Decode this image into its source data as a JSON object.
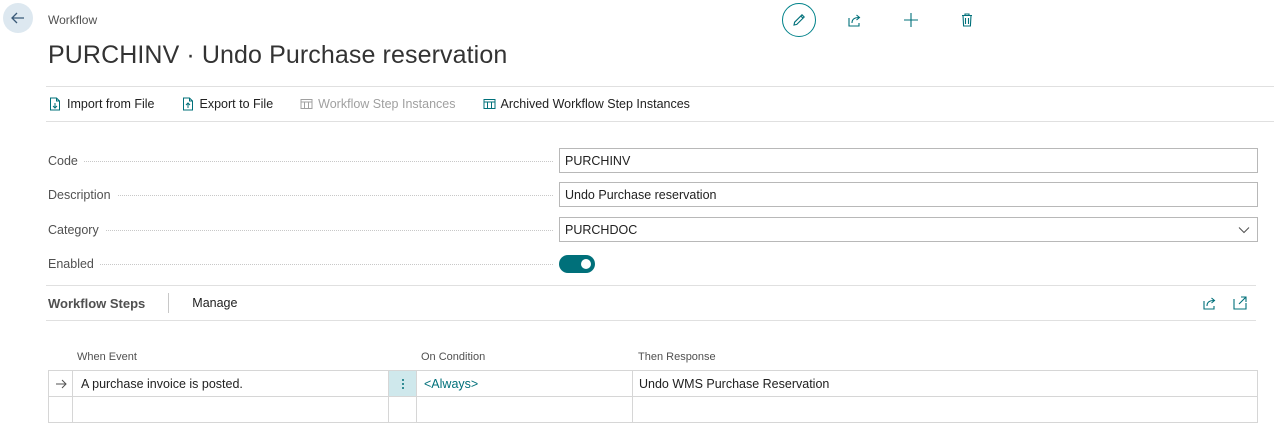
{
  "header": {
    "breadcrumb": "Workflow",
    "title": "PURCHINV · Undo Purchase reservation"
  },
  "actions": [
    {
      "label": "Import from File",
      "icon": "import-file-icon",
      "enabled": true
    },
    {
      "label": "Export to File",
      "icon": "export-file-icon",
      "enabled": true
    },
    {
      "label": "Workflow Step Instances",
      "icon": "table-icon",
      "enabled": false
    },
    {
      "label": "Archived Workflow Step Instances",
      "icon": "table-icon",
      "enabled": true
    }
  ],
  "fields": {
    "code": {
      "label": "Code",
      "value": "PURCHINV"
    },
    "description": {
      "label": "Description",
      "value": "Undo Purchase reservation"
    },
    "category": {
      "label": "Category",
      "value": "PURCHDOC"
    },
    "enabled": {
      "label": "Enabled",
      "value": true
    }
  },
  "steps": {
    "title": "Workflow Steps",
    "manage_label": "Manage",
    "columns": {
      "event": "When Event",
      "condition": "On Condition",
      "response": "Then Response"
    },
    "rows": [
      {
        "event": "A purchase invoice is posted.",
        "condition": "<Always>",
        "response": "Undo WMS Purchase Reservation"
      },
      {
        "event": "",
        "condition": "",
        "response": ""
      }
    ]
  },
  "colors": {
    "accent": "#00707a",
    "accent_border": "#00828a",
    "selected_cell": "#cfe8ec"
  }
}
